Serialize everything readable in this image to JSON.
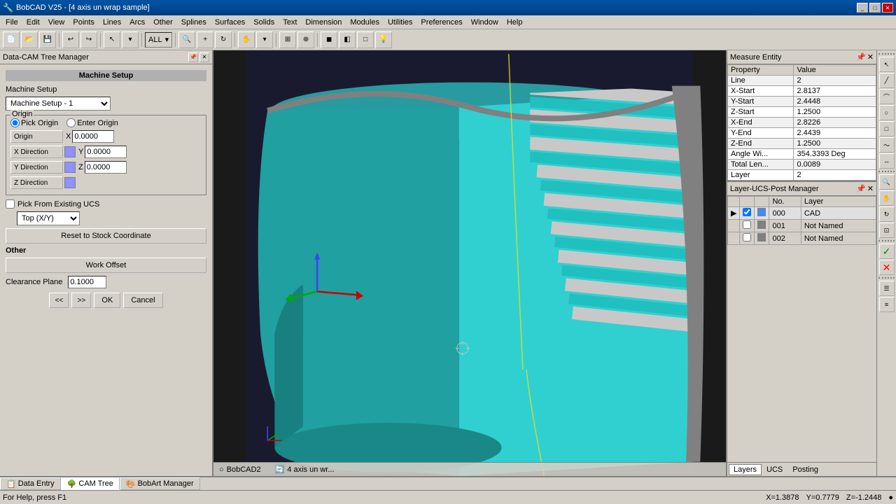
{
  "titleBar": {
    "title": "BobCAD V25 - [4 axis un wrap sample]",
    "icon": "bobcad-icon"
  },
  "menuBar": {
    "items": [
      "File",
      "Edit",
      "View",
      "Points",
      "Lines",
      "Arcs",
      "Other",
      "Splines",
      "Surfaces",
      "Solids",
      "Text",
      "Dimension",
      "Modules",
      "Utilities",
      "Preferences",
      "Window",
      "Help"
    ]
  },
  "toolbar": {
    "dropdown1": "ALL",
    "buttons": [
      "open",
      "save",
      "undo",
      "redo",
      "select",
      "zoom",
      "pan",
      "rotate",
      "measure",
      "snap",
      "grid"
    ]
  },
  "leftPanel": {
    "title": "Data-CAM Tree Manager",
    "machineSetup": {
      "title": "Machine Setup",
      "sectionLabel": "Machine Setup",
      "setupDropdown": "Machine Setup - 1",
      "origin": {
        "label": "Origin",
        "pickOrigin": "Pick Origin",
        "enterOrigin": "Enter Origin",
        "originBtn": "Origin",
        "xDirectionBtn": "X Direction",
        "yDirectionBtn": "Y Direction",
        "zDirectionBtn": "Z Direction",
        "x": "0.0000",
        "y": "0.0000",
        "z": "0.0000"
      },
      "pickFromExistingUCS": "Pick From Existing UCS",
      "ucsDropdown": "Top (X/Y)",
      "resetBtn": "Reset to Stock Coordinate",
      "other": "Other",
      "workOffsetBtn": "Work Offset",
      "clearancePlaneLabel": "Clearance Plane",
      "clearancePlaneValue": "0.1000",
      "buttons": {
        "prev": "<<",
        "next": ">>",
        "ok": "OK",
        "cancel": "Cancel"
      }
    }
  },
  "measureEntity": {
    "title": "Measure Entity",
    "properties": [
      {
        "property": "Property",
        "value": "Value"
      },
      {
        "property": "Line",
        "value": "2"
      },
      {
        "property": "X-Start",
        "value": "2.8137"
      },
      {
        "property": "Y-Start",
        "value": "2.4448"
      },
      {
        "property": "Z-Start",
        "value": "1.2500"
      },
      {
        "property": "X-End",
        "value": "2.8226"
      },
      {
        "property": "Y-End",
        "value": "2.4439"
      },
      {
        "property": "Z-End",
        "value": "1.2500"
      },
      {
        "property": "Angle Wi...",
        "value": "354.3393 Deg"
      },
      {
        "property": "Total Len...",
        "value": "0.0089"
      },
      {
        "property": "Layer",
        "value": "2"
      }
    ]
  },
  "layerManager": {
    "title": "Layer-UCS-Post Manager",
    "columns": [
      "No.",
      "Layer"
    ],
    "rows": [
      {
        "no": "000",
        "layer": "CAD",
        "color": "#00aaff",
        "visible": true,
        "active": true
      },
      {
        "no": "001",
        "layer": "Not Named",
        "color": "#808080",
        "visible": false,
        "active": false
      },
      {
        "no": "002",
        "layer": "Not Named",
        "color": "#808080",
        "visible": false,
        "active": false
      }
    ],
    "tabs": [
      "Layers",
      "UCS",
      "Posting"
    ]
  },
  "viewport": {
    "bobcadLabel": "BobCAD2",
    "operationLabel": "4 axis un wr...",
    "coordinates": {
      "x": "X=1.3878",
      "y": "Y=0.7779",
      "z": "Z=-1.2448"
    }
  },
  "bottomTabs": [
    {
      "label": "Data Entry",
      "icon": "data-icon"
    },
    {
      "label": "CAM Tree",
      "icon": "tree-icon"
    },
    {
      "label": "BobArt Manager",
      "icon": "art-icon"
    }
  ],
  "statusBar": {
    "help": "For Help, press F1"
  }
}
